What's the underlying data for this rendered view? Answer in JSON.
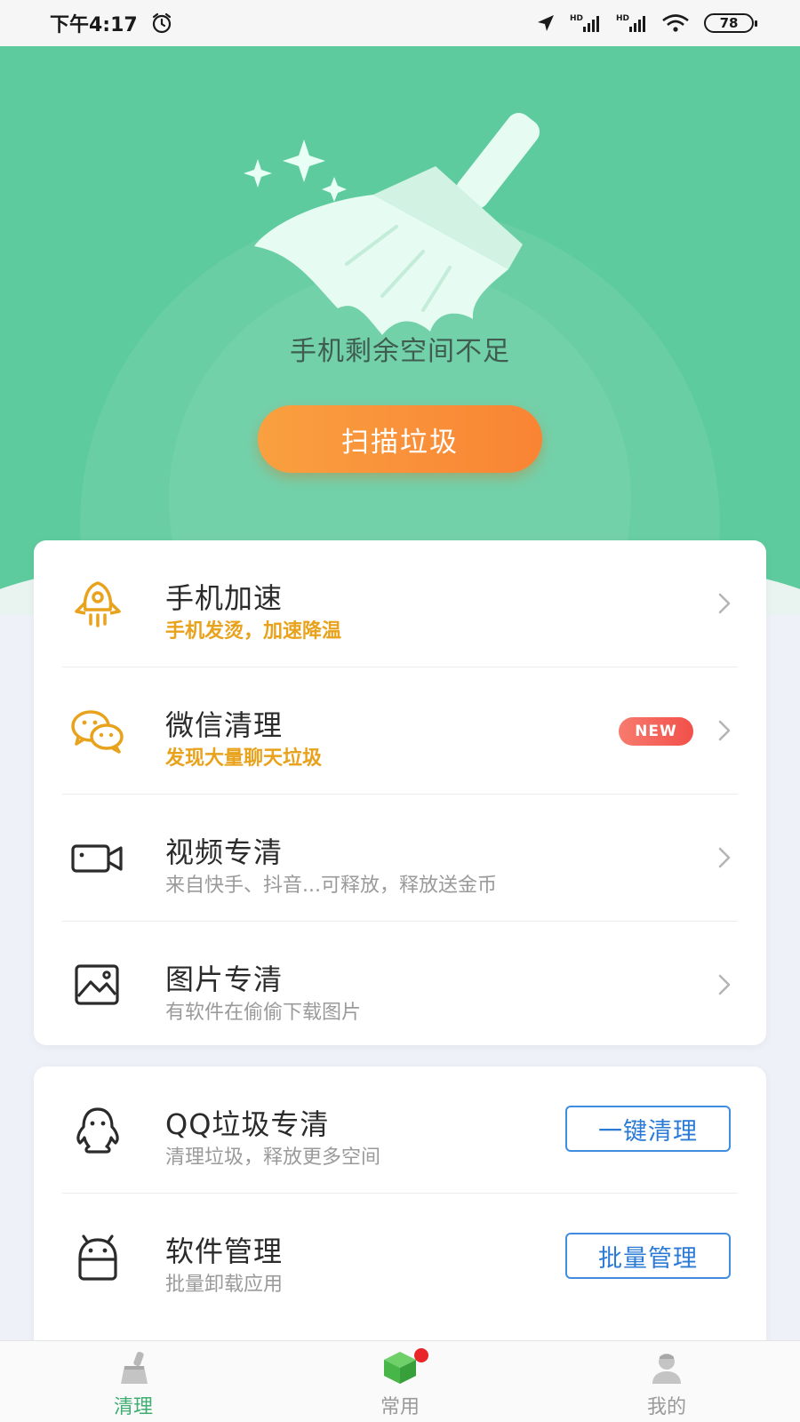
{
  "status_bar": {
    "time": "下午4:17",
    "battery": "78",
    "icons": [
      "alarm-icon",
      "location-icon",
      "hd-signal-icon",
      "hd-signal-icon",
      "wifi-icon",
      "battery-icon"
    ]
  },
  "hero": {
    "message": "手机剩余空间不足",
    "scan_button": "扫描垃圾",
    "background_color": "#5ecb9e",
    "button_color": "#f98c3a",
    "icon": "broom-icon"
  },
  "feature_list": [
    {
      "title": "手机加速",
      "subtitle": "手机发烫，加速降温",
      "icon": "rocket-icon",
      "subtitle_highlight": true
    },
    {
      "title": "微信清理",
      "subtitle": "发现大量聊天垃圾",
      "icon": "wechat-icon",
      "subtitle_highlight": true,
      "badge": "NEW"
    },
    {
      "title": "视频专清",
      "subtitle": "来自快手、抖音...可释放，释放送金币",
      "icon": "video-camera-icon"
    },
    {
      "title": "图片专清",
      "subtitle": "有软件在偷偷下载图片",
      "icon": "image-icon"
    }
  ],
  "tools": [
    {
      "title": "QQ垃圾专清",
      "subtitle": "清理垃圾，释放更多空间",
      "action": "一键清理",
      "icon": "qq-penguin-icon"
    },
    {
      "title": "软件管理",
      "subtitle": "批量卸载应用",
      "action": "批量管理",
      "icon": "android-icon"
    }
  ],
  "bottom_nav": [
    {
      "label": "清理",
      "icon": "broom-icon",
      "active": true
    },
    {
      "label": "常用",
      "icon": "cube-icon",
      "notification_dot": true
    },
    {
      "label": "我的",
      "icon": "user-icon"
    }
  ],
  "colors": {
    "accent_green": "#3fae72",
    "highlight_orange": "#e8a21c",
    "badge_red": "#f2504a",
    "action_blue": "#2b7bd6"
  }
}
